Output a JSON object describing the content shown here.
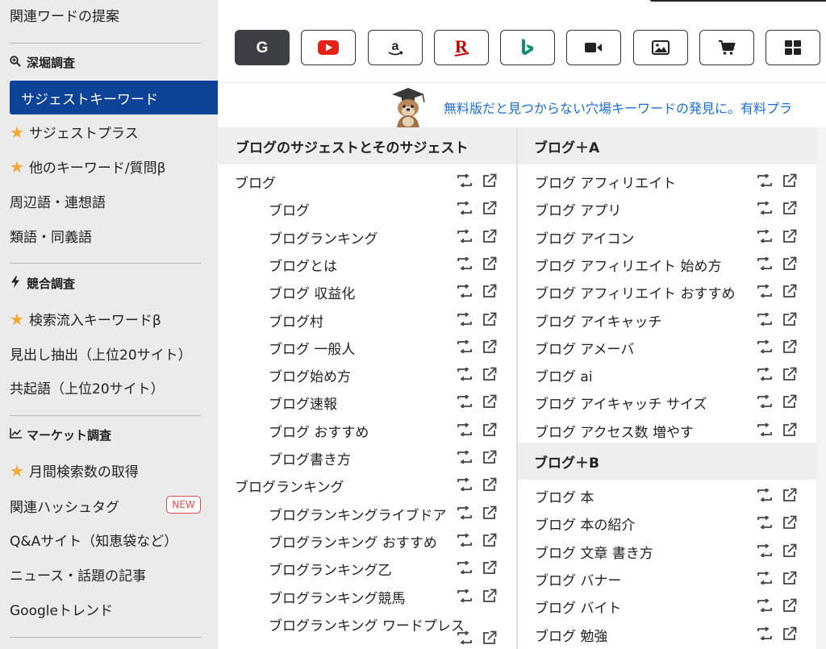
{
  "sidebar": {
    "top_item": "関連ワードの提案",
    "section_deep": "深堀調査",
    "active_item": "サジェストキーワード",
    "items_deep": [
      "サジェストプラス",
      "他のキーワード/質問β",
      "周辺語・連想語",
      "類語・同義語"
    ],
    "section_compete": "競合調査",
    "items_compete": [
      "検索流入キーワードβ",
      "見出し抽出（上位20サイト）",
      "共起語（上位20サイト）"
    ],
    "section_market": "マーケット調査",
    "items_market": [
      "月間検索数の取得",
      "関連ハッシュタグ",
      "Q&Aサイト（知恵袋など）",
      "ニュース・話題の記事",
      "Googleトレンド"
    ],
    "new_badge": "NEW"
  },
  "engines": [
    "google",
    "youtube",
    "amazon",
    "rakuten",
    "bing",
    "video",
    "image",
    "shopping",
    "apps"
  ],
  "engine_labels": {
    "google": "G",
    "rakuten": "R",
    "amazon": "a"
  },
  "banner": {
    "text": "無料版だと見つからない穴場キーワードの発見に。有料プラ"
  },
  "columns": {
    "left": {
      "title": "ブログのサジェストとそのサジェスト",
      "rows": [
        {
          "text": "ブログ",
          "indent": false
        },
        {
          "text": "ブログ",
          "indent": true
        },
        {
          "text": "ブログランキング",
          "indent": true
        },
        {
          "text": "ブログとは",
          "indent": true
        },
        {
          "text": "ブログ 収益化",
          "indent": true
        },
        {
          "text": "ブログ村",
          "indent": true
        },
        {
          "text": "ブログ 一般人",
          "indent": true
        },
        {
          "text": "ブログ始め方",
          "indent": true
        },
        {
          "text": "ブログ速報",
          "indent": true
        },
        {
          "text": "ブログ おすすめ",
          "indent": true
        },
        {
          "text": "ブログ書き方",
          "indent": true
        },
        {
          "text": "ブログランキング",
          "indent": false
        },
        {
          "text": "ブログランキングライブドア",
          "indent": true
        },
        {
          "text": "ブログランキング おすすめ",
          "indent": true
        },
        {
          "text": "ブログランキング乙",
          "indent": true
        },
        {
          "text": "ブログランキング競馬",
          "indent": true
        },
        {
          "text": "ブログランキング ワードプレス",
          "indent": true
        }
      ]
    },
    "right": {
      "title_a": "ブログ＋A",
      "rows_a": [
        "ブログ アフィリエイト",
        "ブログ アプリ",
        "ブログ アイコン",
        "ブログ アフィリエイト 始め方",
        "ブログ アフィリエイト おすすめ",
        "ブログ アイキャッチ",
        "ブログ アメーバ",
        "ブログ ai",
        "ブログ アイキャッチ サイズ",
        "ブログ アクセス数 増やす"
      ],
      "title_b": "ブログ＋B",
      "rows_b": [
        "ブログ 本",
        "ブログ 本の紹介",
        "ブログ 文章 書き方",
        "ブログ バナー",
        "ブログ バイト",
        "ブログ 勉強"
      ]
    }
  }
}
